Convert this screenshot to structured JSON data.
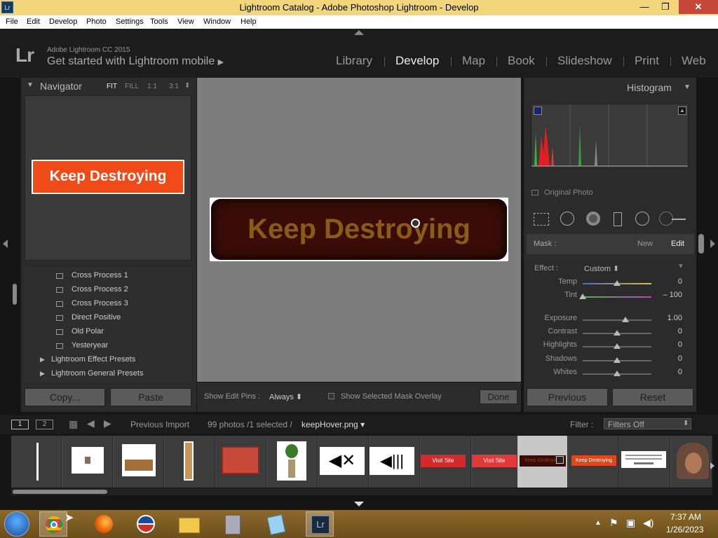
{
  "window": {
    "title": "Lightroom Catalog - Adobe Photoshop Lightroom - Develop",
    "app_badge": "Lr",
    "min": "—",
    "max": "❐",
    "close": "✕"
  },
  "menu": [
    "File",
    "Edit",
    "Develop",
    "Photo",
    "Settings",
    "Tools",
    "View",
    "Window",
    "Help"
  ],
  "identity": {
    "logo": "Lr",
    "version": "Adobe Lightroom CC 2015",
    "mobile": "Get started with Lightroom mobile",
    "mobile_arrow": "▶"
  },
  "modules": [
    "Library",
    "Develop",
    "Map",
    "Book",
    "Slideshow",
    "Print",
    "Web"
  ],
  "active_module": "Develop",
  "navigator": {
    "title": "Navigator",
    "zoom": [
      "FIT",
      "FILL",
      "1:1",
      "3:1"
    ],
    "zoom_arrow": "⬍",
    "preview_text": "Keep Destroying"
  },
  "presets": {
    "items": [
      "Cross Process 1",
      "Cross Process 2",
      "Cross Process 3",
      "Direct Positive",
      "Old Polar",
      "Yesteryear"
    ],
    "folders": [
      "Lightroom Effect Presets",
      "Lightroom General Presets"
    ]
  },
  "left_buttons": {
    "copy": "Copy...",
    "paste": "Paste"
  },
  "main_image": {
    "text": "Keep Destroying"
  },
  "center_toolbar": {
    "edit_pins_label": "Show Edit Pins :",
    "edit_pins_value": "Always",
    "mask_overlay": "Show Selected Mask Overlay",
    "done": "Done"
  },
  "histogram": {
    "title": "Histogram",
    "original_photo": "Original Photo"
  },
  "mask": {
    "label": "Mask :",
    "new": "New",
    "edit": "Edit"
  },
  "effect": {
    "label": "Effect :",
    "value": "Custom"
  },
  "sliders": [
    {
      "label": "Temp",
      "value": "0",
      "pos": 0.5
    },
    {
      "label": "Tint",
      "value": "– 100",
      "pos": 0.0
    },
    {
      "label": "Exposure",
      "value": "1.00",
      "pos": 0.62
    },
    {
      "label": "Contrast",
      "value": "0",
      "pos": 0.5
    },
    {
      "label": "Highlights",
      "value": "0",
      "pos": 0.5
    },
    {
      "label": "Shadows",
      "value": "0",
      "pos": 0.5
    },
    {
      "label": "Whites",
      "value": "0",
      "pos": 0.5
    }
  ],
  "right_buttons": {
    "previous": "Previous",
    "reset": "Reset"
  },
  "bottom_bar": {
    "screen1": "1",
    "screen2": "2",
    "source": "Previous Import",
    "count": "99 photos /1 selected /",
    "filename": "keepHover.png",
    "filter_label": "Filter :",
    "filter_value": "Filters Off"
  },
  "filmstrip": {
    "thumbs": [
      "",
      "chair",
      "desk",
      "plank",
      "frame",
      "plant",
      "mute",
      "volume",
      "Visit Site",
      "Visit Site",
      "Keep Destroying",
      "Keep Destroying",
      "text",
      "face"
    ],
    "selected": 10
  },
  "taskbar": {
    "time": "7:37 AM",
    "date": "1/26/2023"
  }
}
